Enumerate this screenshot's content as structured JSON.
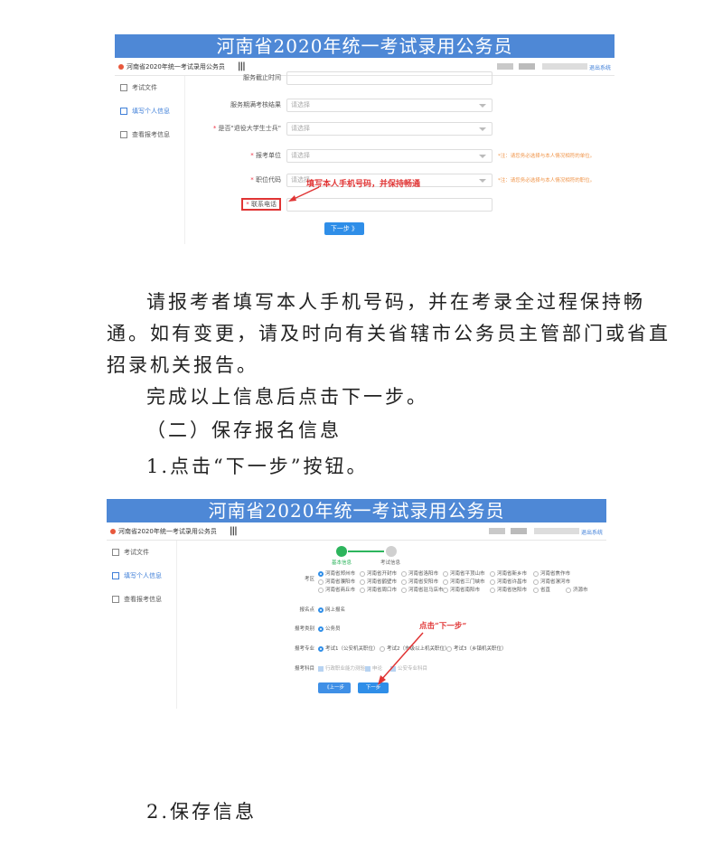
{
  "screenshot1": {
    "banner": "河南省2020年统一考试录用公务员",
    "app_name": "河南省2020年统一考试录用公务员",
    "exit_label": "退出系统",
    "sidebar": [
      "考试文件",
      "填写个人信息",
      "查看报考信息"
    ],
    "top_row_label": "服务截止时间",
    "rows": [
      {
        "label": "服务期满考核结果",
        "placeholder": "请选择",
        "required": false,
        "hint": ""
      },
      {
        "label": "是否\"退役大学生士兵\"",
        "placeholder": "请选择",
        "required": true,
        "hint": ""
      },
      {
        "label": "报考单位",
        "placeholder": "请选择",
        "required": true,
        "hint": "*注：请您务必选择与本人情况相符的单位。"
      },
      {
        "label": "职位代码",
        "placeholder": "请选择",
        "required": true,
        "hint": "*注：请您务必选择与本人情况相符的职位。"
      }
    ],
    "phone_label": "联系电话",
    "annotation": "填写本人手机号码，并保持畅通",
    "next_button": "下一步 》"
  },
  "paragraph1": [
    "请报考者填写本人手机号码，并在考录全过程保持畅",
    "通。如有变更，请及时向有关省辖市公务员主管部门或省直",
    "招录机关报告。"
  ],
  "paragraph2": "完成以上信息后点击下一步。",
  "section_heading": "（二）保存报名信息",
  "step1_text": "1.点击“下一步”按钮。",
  "screenshot2": {
    "banner": "河南省2020年统一考试录用公务员",
    "app_name": "河南省2020年统一考试录用公务员",
    "exit_label": "退出系统",
    "sidebar": [
      "考试文件",
      "填写个人信息",
      "查看报考信息"
    ],
    "steps": [
      "基本信息",
      "考试信息"
    ],
    "region_label": "考区",
    "regions": [
      [
        "河南省郑州市",
        "河南省开封市",
        "河南省洛阳市",
        "河南省平顶山市",
        "河南省新乡市",
        "河南省焦作市"
      ],
      [
        "河南省濮阳市",
        "河南省鹤壁市",
        "河南省安阳市",
        "河南省三门峡市",
        "河南省许昌市",
        "河南省漯河市"
      ],
      [
        "河南省商丘市",
        "河南省周口市",
        "河南省驻马店市",
        "河南省南阳市",
        "河南省信阳市",
        "省直",
        "济源市"
      ]
    ],
    "exam_point_label": "报名点",
    "exam_point": "网上报名",
    "category_label": "报考类别",
    "category": "公务员",
    "major_label": "报考专业",
    "majors": [
      "考试1（公安机关职位）",
      "考试2（市级以上机关职位）",
      "考试3（乡镇机关职位）"
    ],
    "subjects_label": "报考科目",
    "subjects": [
      "行政职业能力测验",
      "申论",
      "公安专业科目"
    ],
    "prev_button": "《上一步",
    "next_button": "下一步",
    "annotation": "点击“下一步”"
  },
  "step2_text": "2.保存信息",
  "colors": {
    "banner": "#4e88d6",
    "accent": "#2f8ee8",
    "annotation": "#e03434",
    "hint": "#f0954a"
  }
}
